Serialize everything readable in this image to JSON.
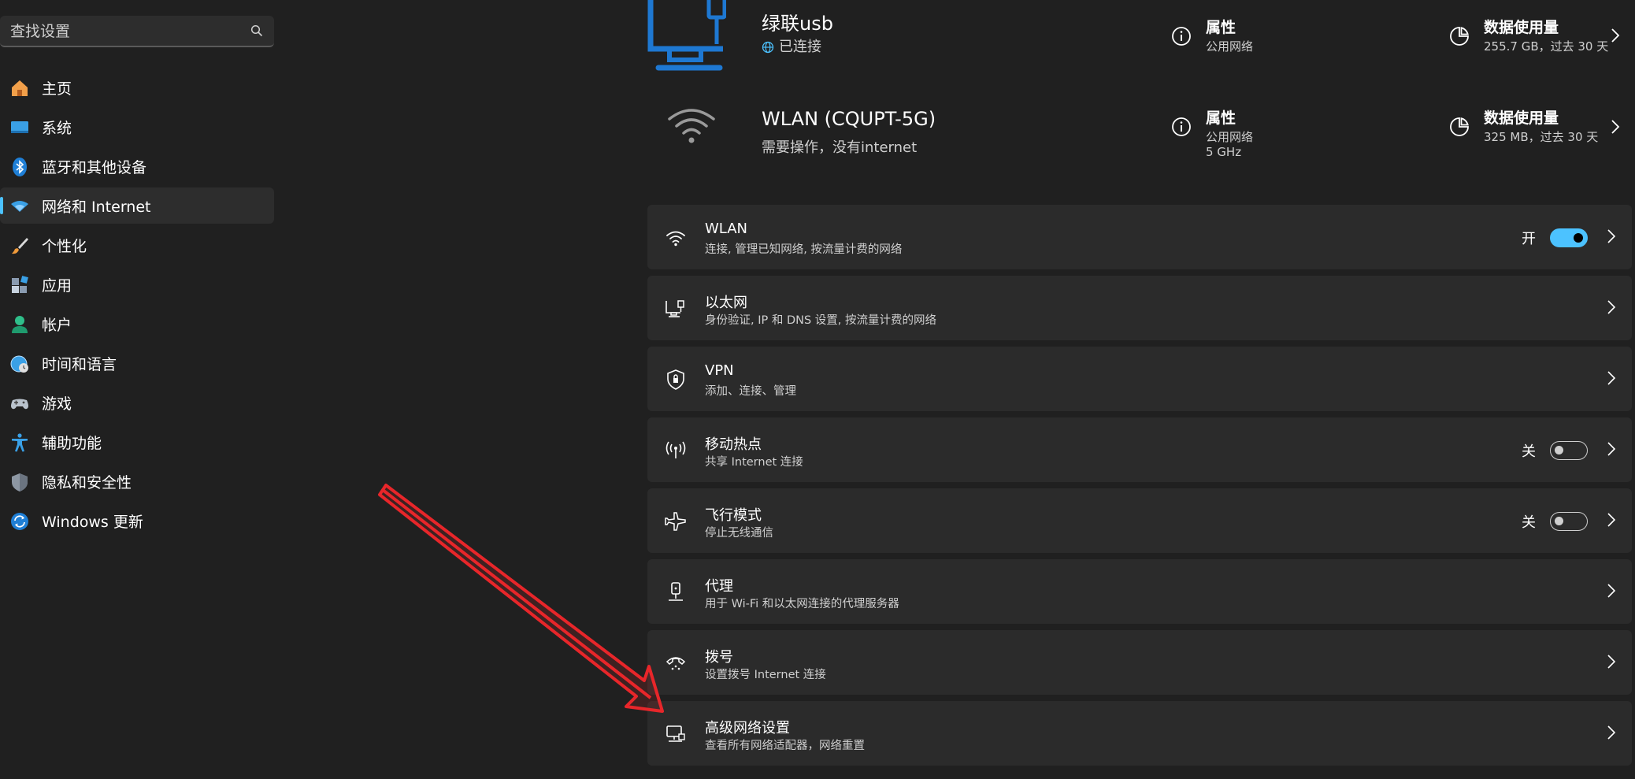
{
  "search": {
    "placeholder": "查找设置"
  },
  "sidebar": {
    "items": [
      {
        "label": "主页",
        "icon": "home-icon"
      },
      {
        "label": "系统",
        "icon": "system-icon"
      },
      {
        "label": "蓝牙和其他设备",
        "icon": "bluetooth-icon"
      },
      {
        "label": "网络和 Internet",
        "icon": "network-wifi-icon",
        "active": true
      },
      {
        "label": "个性化",
        "icon": "paintbrush-icon"
      },
      {
        "label": "应用",
        "icon": "apps-icon"
      },
      {
        "label": "帐户",
        "icon": "account-icon"
      },
      {
        "label": "时间和语言",
        "icon": "time-language-icon"
      },
      {
        "label": "游戏",
        "icon": "gamepad-icon"
      },
      {
        "label": "辅助功能",
        "icon": "accessibility-icon"
      },
      {
        "label": "隐私和安全性",
        "icon": "shield-icon"
      },
      {
        "label": "Windows 更新",
        "icon": "windows-update-icon"
      }
    ]
  },
  "networks": [
    {
      "name": "绿联usb",
      "status": "已连接",
      "icon": "ethernet-monitor-icon",
      "properties": {
        "title": "属性",
        "lines": [
          "公用网络"
        ]
      },
      "usage": {
        "title": "数据使用量",
        "value": "255.7 GB，过去 30 天"
      }
    },
    {
      "name": "WLAN (CQUPT-5G)",
      "status": "需要操作，没有internet",
      "icon": "wifi-large-icon",
      "properties": {
        "title": "属性",
        "lines": [
          "公用网络",
          "5 GHz"
        ]
      },
      "usage": {
        "title": "数据使用量",
        "value": "325 MB，过去 30 天"
      }
    }
  ],
  "settings": [
    {
      "title": "WLAN",
      "subtitle": "连接, 管理已知网络, 按流量计费的网络",
      "icon": "wifi-icon",
      "toggle": {
        "label": "开",
        "on": true
      }
    },
    {
      "title": "以太网",
      "subtitle": "身份验证, IP 和 DNS 设置, 按流量计费的网络",
      "icon": "ethernet-icon"
    },
    {
      "title": "VPN",
      "subtitle": "添加、连接、管理",
      "icon": "vpn-shield-icon"
    },
    {
      "title": "移动热点",
      "subtitle": "共享 Internet 连接",
      "icon": "hotspot-icon",
      "toggle": {
        "label": "关",
        "on": false
      }
    },
    {
      "title": "飞行模式",
      "subtitle": "停止无线通信",
      "icon": "airplane-icon",
      "toggle": {
        "label": "关",
        "on": false
      }
    },
    {
      "title": "代理",
      "subtitle": "用于 Wi-Fi 和以太网连接的代理服务器",
      "icon": "proxy-icon"
    },
    {
      "title": "拨号",
      "subtitle": "设置拨号 Internet 连接",
      "icon": "dialup-icon"
    },
    {
      "title": "高级网络设置",
      "subtitle": "查看所有网络适配器，网络重置",
      "icon": "advanced-network-icon"
    }
  ],
  "colors": {
    "accent": "#4cc2ff",
    "background": "#202020",
    "card": "#2b2b2b",
    "annotation_arrow": "#e8262a"
  }
}
